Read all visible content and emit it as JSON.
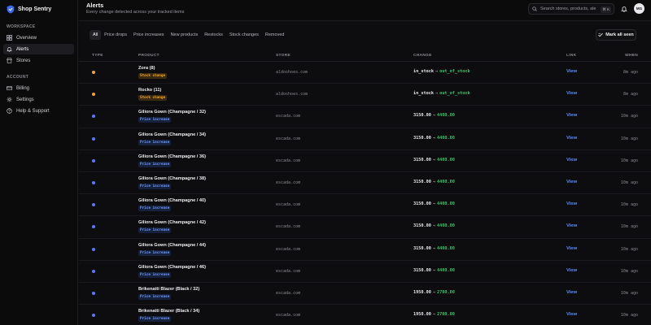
{
  "brand": {
    "name": "Shop Sentry"
  },
  "sidebar": {
    "workspace_label": "WORKSPACE",
    "account_label": "ACCOUNT",
    "workspace_items": [
      {
        "label": "Overview",
        "icon": "grid-icon"
      },
      {
        "label": "Alerts",
        "icon": "bell-icon"
      },
      {
        "label": "Stores",
        "icon": "store-icon"
      }
    ],
    "account_items": [
      {
        "label": "Billing",
        "icon": "card-icon"
      },
      {
        "label": "Settings",
        "icon": "gear-icon"
      },
      {
        "label": "Help & Support",
        "icon": "help-icon"
      }
    ]
  },
  "header": {
    "title": "Alerts",
    "subtitle": "Every change detected across your tracked items",
    "search_placeholder": "Search stores, products, ale",
    "search_shortcut": "⌘ K",
    "avatar_initials": "MG"
  },
  "filters": {
    "tabs": [
      "All",
      "Price drops",
      "Price increases",
      "New products",
      "Restocks",
      "Stock changes",
      "Removed"
    ],
    "active": "All",
    "mark_all_label": "Mark all seen"
  },
  "table": {
    "columns": {
      "type": "TYPE",
      "product": "PRODUCT",
      "store": "STORE",
      "change": "CHANGE",
      "link": "LINK",
      "when": "WHEN"
    },
    "rows": [
      {
        "dot_color": "#f5a524",
        "product": "Zora (8)",
        "badge": "Stock change",
        "badge_kind": "stock",
        "store": "aldoshoes.com",
        "from": "in_stock",
        "to": "out_of_stock",
        "link": "View",
        "when": "8m ago"
      },
      {
        "dot_color": "#f5a524",
        "product": "Rocko (11)",
        "badge": "Stock change",
        "badge_kind": "stock",
        "store": "aldoshoes.com",
        "from": "in_stock",
        "to": "out_of_stock",
        "link": "View",
        "when": "8m ago"
      },
      {
        "dot_color": "#4d7cff",
        "product": "Giliora Gown (Champagne / 32)",
        "badge": "Price increase",
        "badge_kind": "price",
        "store": "escada.com",
        "from": "3150.00",
        "to": "4400.00",
        "link": "View",
        "when": "10m ago"
      },
      {
        "dot_color": "#4d7cff",
        "product": "Giliora Gown (Champagne / 34)",
        "badge": "Price increase",
        "badge_kind": "price",
        "store": "escada.com",
        "from": "3150.00",
        "to": "4400.00",
        "link": "View",
        "when": "10m ago"
      },
      {
        "dot_color": "#4d7cff",
        "product": "Giliora Gown (Champagne / 36)",
        "badge": "Price increase",
        "badge_kind": "price",
        "store": "escada.com",
        "from": "3150.00",
        "to": "4400.00",
        "link": "View",
        "when": "10m ago"
      },
      {
        "dot_color": "#4d7cff",
        "product": "Giliora Gown (Champagne / 38)",
        "badge": "Price increase",
        "badge_kind": "price",
        "store": "escada.com",
        "from": "3150.00",
        "to": "4400.00",
        "link": "View",
        "when": "10m ago"
      },
      {
        "dot_color": "#4d7cff",
        "product": "Giliora Gown (Champagne / 40)",
        "badge": "Price increase",
        "badge_kind": "price",
        "store": "escada.com",
        "from": "3150.00",
        "to": "4400.00",
        "link": "View",
        "when": "10m ago"
      },
      {
        "dot_color": "#4d7cff",
        "product": "Giliora Gown (Champagne / 42)",
        "badge": "Price increase",
        "badge_kind": "price",
        "store": "escada.com",
        "from": "3150.00",
        "to": "4400.00",
        "link": "View",
        "when": "10m ago"
      },
      {
        "dot_color": "#4d7cff",
        "product": "Giliora Gown (Champagne / 44)",
        "badge": "Price increase",
        "badge_kind": "price",
        "store": "escada.com",
        "from": "3150.00",
        "to": "4400.00",
        "link": "View",
        "when": "10m ago"
      },
      {
        "dot_color": "#4d7cff",
        "product": "Giliora Gown (Champagne / 46)",
        "badge": "Price increase",
        "badge_kind": "price",
        "store": "escada.com",
        "from": "3150.00",
        "to": "4400.00",
        "link": "View",
        "when": "10m ago"
      },
      {
        "dot_color": "#4d7cff",
        "product": "Brikenatti Blazer (Black / 32)",
        "badge": "Price increase",
        "badge_kind": "price",
        "store": "escada.com",
        "from": "1950.00",
        "to": "2700.00",
        "link": "View",
        "when": "10m ago"
      },
      {
        "dot_color": "#4d7cff",
        "product": "Brikenatti Blazer (Black / 34)",
        "badge": "Price increase",
        "badge_kind": "price",
        "store": "escada.com",
        "from": "1950.00",
        "to": "2700.00",
        "link": "View",
        "when": "10m ago"
      }
    ]
  }
}
